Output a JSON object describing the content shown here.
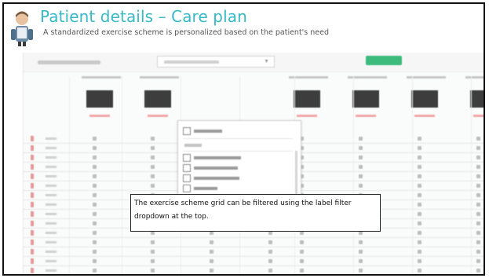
{
  "header": {
    "title": "Patient details – Care plan",
    "subtitle": "A standardized exercise scheme is personalized based on the patient's need"
  },
  "callout": {
    "text": "The exercise scheme grid can be filtered using the label filter dropdown at the top."
  },
  "colors": {
    "title": "#39b9c4",
    "accent_button": "#3dbb7d",
    "row_marker": "#e59a9a"
  },
  "icons": {
    "person": "person-illustration-icon",
    "checkbox": "checkbox-icon"
  }
}
